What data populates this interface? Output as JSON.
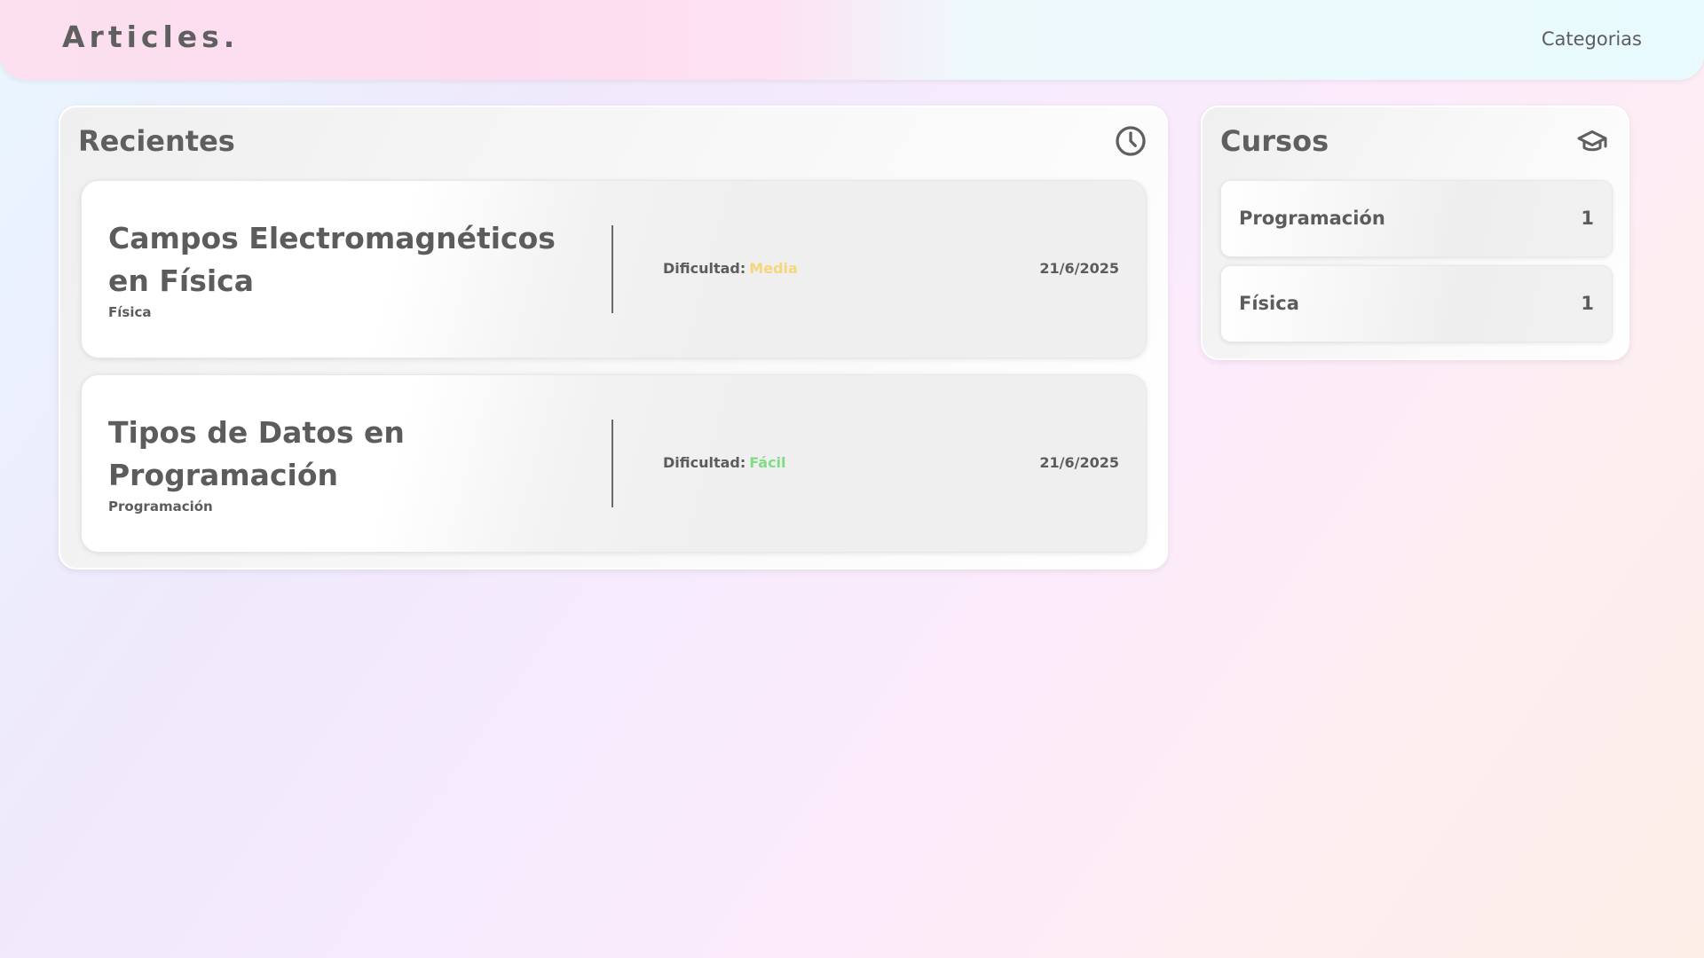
{
  "navbar": {
    "brand": "Articles.",
    "link": "Categorias"
  },
  "recientes": {
    "title": "Recientes",
    "icon": "clock-icon",
    "articles": [
      {
        "title": "Campos Electromagnéticos en Física",
        "category": "Física",
        "difficulty_label": "Dificultad:",
        "difficulty": "Media",
        "difficulty_color": "#f5d77a",
        "date": "21/6/2025"
      },
      {
        "title": "Tipos de Datos en Programación",
        "category": "Programación",
        "difficulty_label": "Dificultad:",
        "difficulty": "Fácil",
        "difficulty_color": "#7fdc84",
        "date": "21/6/2025"
      }
    ]
  },
  "cursos": {
    "title": "Cursos",
    "icon": "graduation-cap-icon",
    "items": [
      {
        "name": "Programación",
        "count": "1"
      },
      {
        "name": "Física",
        "count": "1"
      }
    ]
  }
}
